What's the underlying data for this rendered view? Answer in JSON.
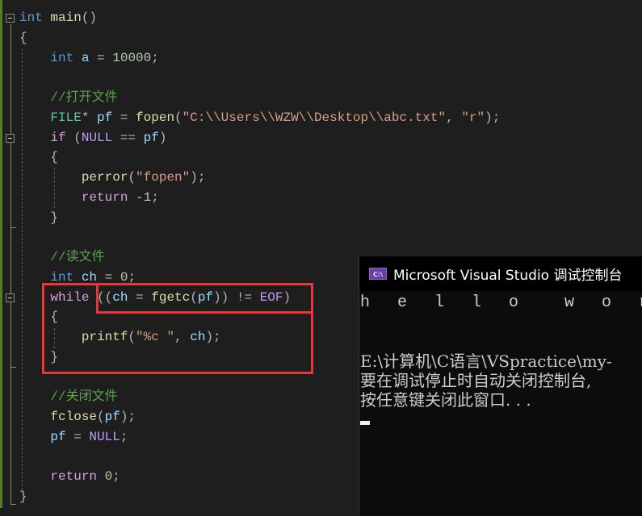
{
  "editor": {
    "code_lines": [
      {
        "tokens": [
          {
            "t": "int",
            "c": "kw"
          },
          {
            "t": " "
          },
          {
            "t": "main",
            "c": "fn"
          },
          {
            "t": "()",
            "c": "punc"
          }
        ]
      },
      {
        "tokens": [
          {
            "t": "{",
            "c": "punc"
          }
        ]
      },
      {
        "tokens": [
          {
            "t": "    "
          },
          {
            "t": "int",
            "c": "kw"
          },
          {
            "t": " "
          },
          {
            "t": "a",
            "c": "var"
          },
          {
            "t": " = ",
            "c": "punc"
          },
          {
            "t": "10000",
            "c": "num"
          },
          {
            "t": ";",
            "c": "punc"
          }
        ]
      },
      {
        "tokens": []
      },
      {
        "tokens": [
          {
            "t": "    "
          },
          {
            "t": "//打开文件",
            "c": "cm"
          }
        ]
      },
      {
        "tokens": [
          {
            "t": "    "
          },
          {
            "t": "FILE",
            "c": "type"
          },
          {
            "t": "* ",
            "c": "punc"
          },
          {
            "t": "pf",
            "c": "var"
          },
          {
            "t": " = ",
            "c": "punc"
          },
          {
            "t": "fopen",
            "c": "fn"
          },
          {
            "t": "(",
            "c": "punc"
          },
          {
            "t": "\"C:\\\\Users\\\\WZW\\\\Desktop\\\\abc.txt\"",
            "c": "str"
          },
          {
            "t": ", ",
            "c": "punc"
          },
          {
            "t": "\"r\"",
            "c": "str"
          },
          {
            "t": ");",
            "c": "punc"
          }
        ]
      },
      {
        "tokens": [
          {
            "t": "    "
          },
          {
            "t": "if",
            "c": "kw2"
          },
          {
            "t": " (",
            "c": "punc"
          },
          {
            "t": "NULL",
            "c": "mac"
          },
          {
            "t": " == ",
            "c": "punc"
          },
          {
            "t": "pf",
            "c": "var"
          },
          {
            "t": ")",
            "c": "punc"
          }
        ]
      },
      {
        "tokens": [
          {
            "t": "    "
          },
          {
            "t": "{",
            "c": "punc"
          }
        ]
      },
      {
        "tokens": [
          {
            "t": "        "
          },
          {
            "t": "perror",
            "c": "fn"
          },
          {
            "t": "(",
            "c": "punc"
          },
          {
            "t": "\"fopen\"",
            "c": "str"
          },
          {
            "t": ");",
            "c": "punc"
          }
        ]
      },
      {
        "tokens": [
          {
            "t": "        "
          },
          {
            "t": "return",
            "c": "kw2"
          },
          {
            "t": " "
          },
          {
            "t": "-1",
            "c": "num"
          },
          {
            "t": ";",
            "c": "punc"
          }
        ]
      },
      {
        "tokens": [
          {
            "t": "    "
          },
          {
            "t": "}",
            "c": "punc"
          }
        ]
      },
      {
        "tokens": []
      },
      {
        "tokens": [
          {
            "t": "    "
          },
          {
            "t": "//读文件",
            "c": "cm"
          }
        ]
      },
      {
        "tokens": [
          {
            "t": "    "
          },
          {
            "t": "int",
            "c": "kw"
          },
          {
            "t": " "
          },
          {
            "t": "ch",
            "c": "var"
          },
          {
            "t": " = ",
            "c": "punc"
          },
          {
            "t": "0",
            "c": "num"
          },
          {
            "t": ";",
            "c": "punc"
          }
        ]
      },
      {
        "tokens": [
          {
            "t": "    "
          },
          {
            "t": "while",
            "c": "kw2"
          },
          {
            "t": " ((",
            "c": "punc"
          },
          {
            "t": "ch",
            "c": "var"
          },
          {
            "t": " = ",
            "c": "punc"
          },
          {
            "t": "fgetc",
            "c": "fn"
          },
          {
            "t": "(",
            "c": "punc"
          },
          {
            "t": "pf",
            "c": "var"
          },
          {
            "t": ")) != ",
            "c": "punc"
          },
          {
            "t": "EOF",
            "c": "mac"
          },
          {
            "t": ")",
            "c": "punc"
          }
        ]
      },
      {
        "tokens": [
          {
            "t": "    "
          },
          {
            "t": "{",
            "c": "punc"
          }
        ]
      },
      {
        "tokens": [
          {
            "t": "        "
          },
          {
            "t": "printf",
            "c": "fn"
          },
          {
            "t": "(",
            "c": "punc"
          },
          {
            "t": "\"%c \"",
            "c": "str"
          },
          {
            "t": ", ",
            "c": "punc"
          },
          {
            "t": "ch",
            "c": "var"
          },
          {
            "t": ");",
            "c": "punc"
          }
        ]
      },
      {
        "tokens": [
          {
            "t": "    "
          },
          {
            "t": "}",
            "c": "punc"
          }
        ]
      },
      {
        "tokens": []
      },
      {
        "tokens": [
          {
            "t": "    "
          },
          {
            "t": "//关闭文件",
            "c": "cm"
          }
        ]
      },
      {
        "tokens": [
          {
            "t": "    "
          },
          {
            "t": "fclose",
            "c": "fn"
          },
          {
            "t": "(",
            "c": "punc"
          },
          {
            "t": "pf",
            "c": "var"
          },
          {
            "t": ");",
            "c": "punc"
          }
        ]
      },
      {
        "tokens": [
          {
            "t": "    "
          },
          {
            "t": "pf",
            "c": "var"
          },
          {
            "t": " = ",
            "c": "punc"
          },
          {
            "t": "NULL",
            "c": "mac"
          },
          {
            "t": ";",
            "c": "punc"
          }
        ]
      },
      {
        "tokens": []
      },
      {
        "tokens": [
          {
            "t": "    "
          },
          {
            "t": "return",
            "c": "kw2"
          },
          {
            "t": " "
          },
          {
            "t": "0",
            "c": "num"
          },
          {
            "t": ";",
            "c": "punc"
          }
        ]
      },
      {
        "tokens": [
          {
            "t": "}",
            "c": "punc"
          }
        ]
      }
    ],
    "highlight_color": "#e8373a"
  },
  "console": {
    "icon": "console-app-icon",
    "icon_text": "C:\\",
    "title": "Microsoft Visual Studio 调试控制台",
    "output_lines": [
      "h e l l o  w o r l d",
      "",
      "",
      "E:\\计算机\\C语言\\VSpractice\\my-",
      "要在调试停止时自动关闭控制台,",
      "按任意键关闭此窗口. . ."
    ]
  }
}
